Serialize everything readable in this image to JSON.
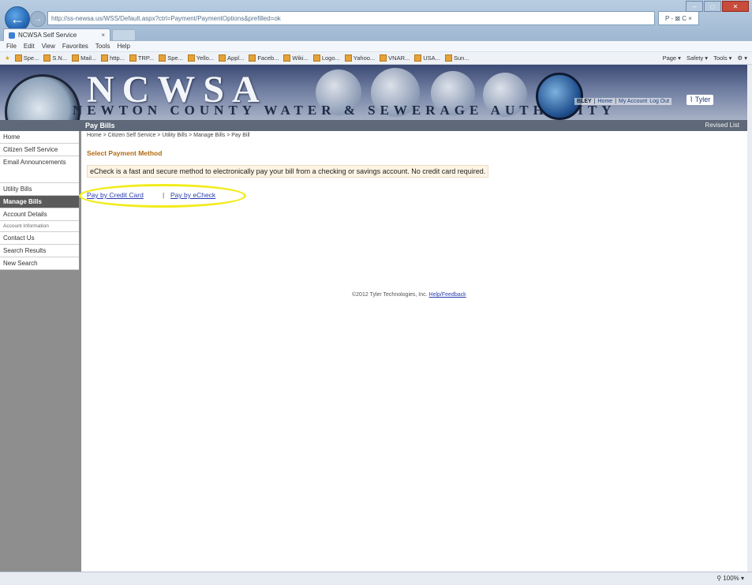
{
  "browser": {
    "url": "http://ss-newsa.us/WSS/Default.aspx?ctrl=Payment/PaymentOptions&prefilled=ok",
    "tab_title": "NCWSA Self Service",
    "tab_close": "×",
    "search_label": "P - ⊠ C ×",
    "menu": [
      "File",
      "Edit",
      "View",
      "Favorites",
      "Tools",
      "Help"
    ],
    "favorites": [
      "Spe...",
      "S.N...",
      "Mail...",
      "http...",
      "TRP...",
      "Spe...",
      "Yello...",
      "Appl...",
      "Faceb...",
      "Wiki...",
      "Logo...",
      "Yahoo...",
      "VNAR...",
      "USA...",
      "Sun..."
    ],
    "commands": [
      "Page ▾",
      "Safety ▾",
      "Tools ▾",
      "⚙ ▾"
    ],
    "zoom": "⚲ 100% ▾"
  },
  "banner": {
    "logo": "NCWSA",
    "subtitle": "NEWTON COUNTY WATER & SEWERAGE AUTHORITY",
    "account_label": "BLEY",
    "links": [
      "Home",
      "My Account",
      "Log Out"
    ],
    "brand": "Tyler"
  },
  "band": {
    "page_title": "Pay Bills",
    "right": "Revised List"
  },
  "sidebar": {
    "items": [
      {
        "label": "Home"
      },
      {
        "label": "Citizen Self Service"
      },
      {
        "label": "Email Announcements"
      },
      {
        "label": "Utility Bills"
      },
      {
        "label": "Manage Bills"
      },
      {
        "label": "Account Details"
      },
      {
        "label": "Account Information"
      },
      {
        "label": "Contact Us"
      },
      {
        "label": "Search Results"
      },
      {
        "label": "New Search"
      }
    ]
  },
  "main": {
    "breadcrumb": "Home > Citizen Self Service > Utility Bills > Manage Bills > Pay Bill",
    "section_title": "Select Payment Method",
    "info": "eCheck is a fast and secure method to electronically pay your bill from a checking or savings account. No credit card required.",
    "pay_credit": "Pay by Credit Card",
    "separator": "|",
    "pay_echeck": "Pay by eCheck",
    "footer_text": "©2012 Tyler Technologies, Inc.",
    "footer_link": "Help/Feedback"
  }
}
